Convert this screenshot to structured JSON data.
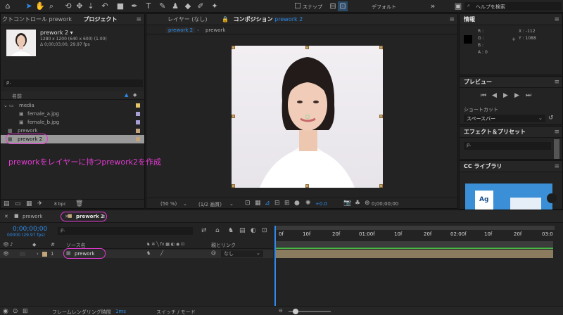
{
  "toolbar": {
    "snap_label": "スナップ",
    "workspace_label": "デフォルト",
    "help_search_placeholder": "ヘルプを検索"
  },
  "project_panel": {
    "tab_effect_controls": "クトコントロール prework",
    "tab_project": "プロジェクト",
    "preview_name": "prework 2 ▾",
    "preview_info1": "1280 x 1200 (640 x 600) (1.00)",
    "preview_info2": "Δ 0;00;03;00, 29.97 fps",
    "search_placeholder": "ρ.",
    "column_name": "名前",
    "items": [
      {
        "label": "media",
        "type": "folder"
      },
      {
        "label": "female_a.jpg",
        "type": "file"
      },
      {
        "label": "female_b.jpg",
        "type": "file"
      },
      {
        "label": "prework",
        "type": "comp"
      },
      {
        "label": "prework 2",
        "type": "comp",
        "selected": true
      }
    ],
    "bpc": "8 bpc"
  },
  "viewer": {
    "tab_layer": "レイヤー (なし)",
    "tab_composition": "コンポジション",
    "comp_name": "prework 2",
    "breadcrumb": [
      "prework 2",
      "prework"
    ],
    "annotation": "preworkをレイヤーに持つprework2を作成",
    "zoom": "(50 %)",
    "resolution": "(1/2 画質)",
    "exposure": "+0.0",
    "timecode": "0;00;00;00"
  },
  "info_panel": {
    "title": "情報",
    "rgba": [
      "R :",
      "G :",
      "B :",
      "A : 0"
    ],
    "x": "X : -112",
    "y": "Y : 1088"
  },
  "preview_panel": {
    "title": "プレビュー",
    "shortcut_label": "ショートカット",
    "shortcut_value": "スペースバー"
  },
  "effects_panel": {
    "title": "エフェクト＆プリセット",
    "search_placeholder": "ρ."
  },
  "library_panel": {
    "title": "CC ライブラリ"
  },
  "timeline": {
    "tabs": [
      "prework",
      "prework 2"
    ],
    "timecode": "0;00;00;00",
    "frames": "00000 (29.97 fps)",
    "search_placeholder": "ρ.",
    "col_number": "#",
    "col_source": "ソース名",
    "col_parent": "親とリンク",
    "layer_index": "1",
    "layer_name": "prework",
    "parent_value": "なし",
    "ruler_labels": [
      "0f",
      "10f",
      "20f",
      "01:00f",
      "10f",
      "20f",
      "02:00f",
      "10f",
      "20f",
      "03:0"
    ],
    "footer_render": "フレームレンダリング時間",
    "footer_render_val": "1ms",
    "footer_switch": "スイッチ / モード"
  },
  "colors": {
    "accent_blue": "#2d8ceb",
    "annotation_magenta": "#e33ad3",
    "track_tan": "#8b7c5f",
    "green_bar": "#4ab54a"
  }
}
